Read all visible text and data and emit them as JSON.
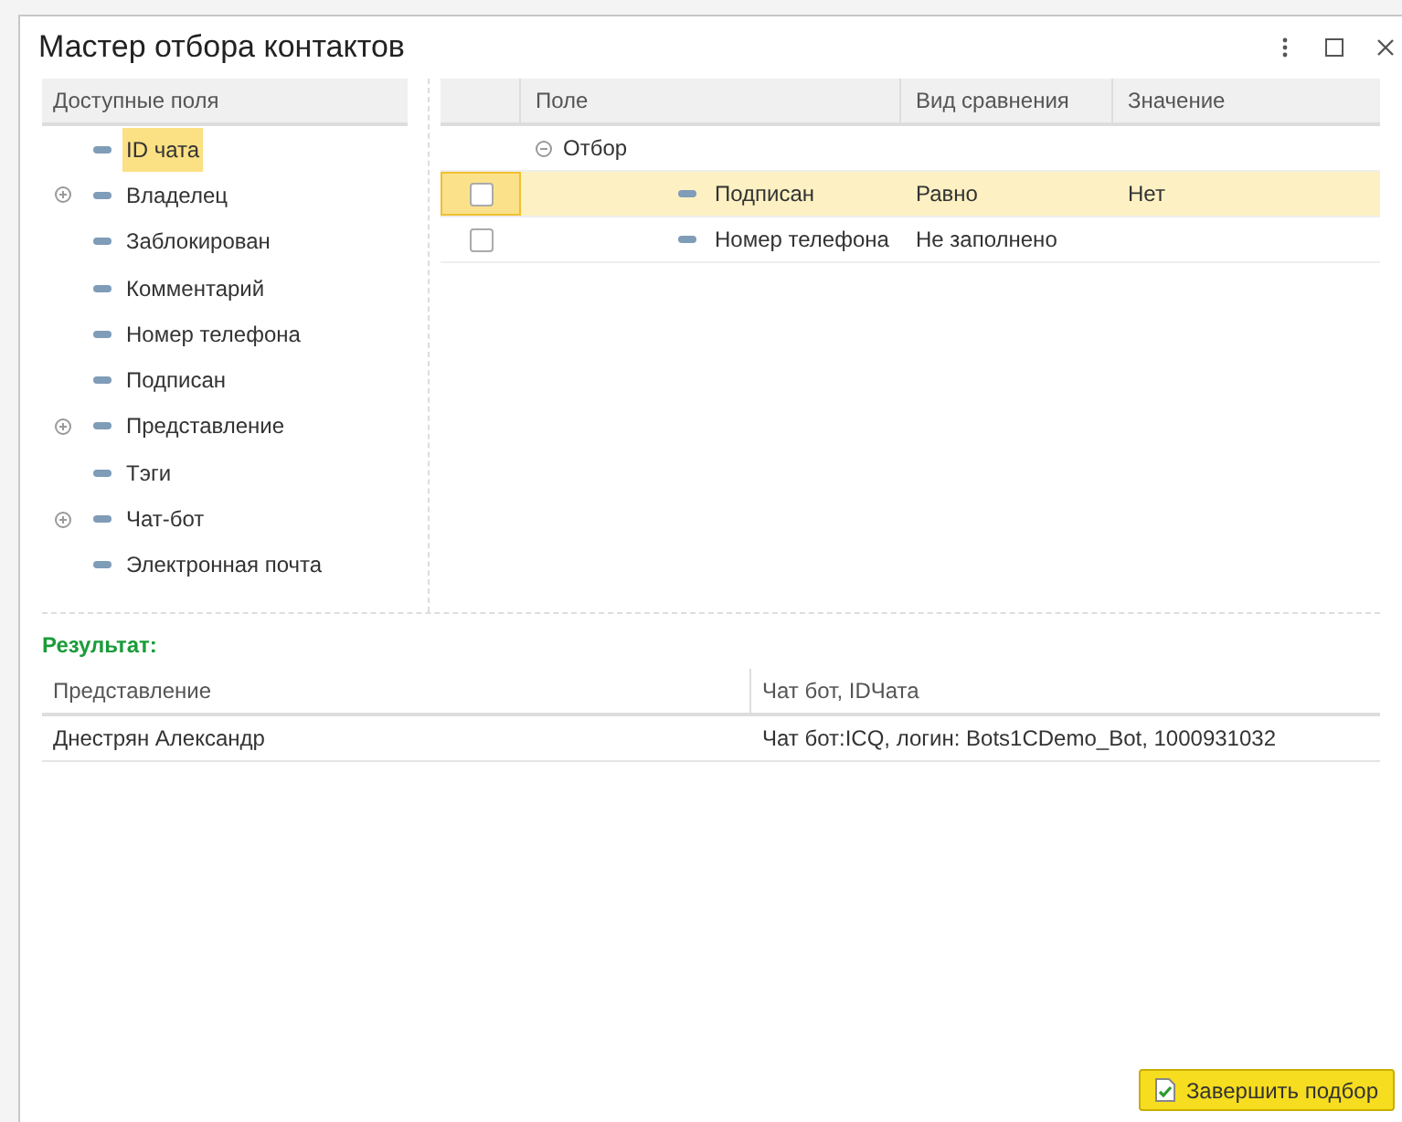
{
  "window": {
    "title": "Мастер отбора контактов"
  },
  "fields": {
    "header": "Доступные поля",
    "items": [
      {
        "label": "ID чата",
        "expandable": false,
        "selected": true
      },
      {
        "label": "Владелец",
        "expandable": true,
        "selected": false
      },
      {
        "label": "Заблокирован",
        "expandable": false,
        "selected": false
      },
      {
        "label": "Комментарий",
        "expandable": false,
        "selected": false
      },
      {
        "label": "Номер телефона",
        "expandable": false,
        "selected": false
      },
      {
        "label": "Подписан",
        "expandable": false,
        "selected": false
      },
      {
        "label": "Представление",
        "expandable": true,
        "selected": false
      },
      {
        "label": "Тэги",
        "expandable": false,
        "selected": false
      },
      {
        "label": "Чат-бот",
        "expandable": true,
        "selected": false
      },
      {
        "label": "Электронная почта",
        "expandable": false,
        "selected": false
      }
    ]
  },
  "filter": {
    "columns": [
      "Поле",
      "Вид сравнения",
      "Значение"
    ],
    "group": {
      "label": "Отбор",
      "expanded": true
    },
    "rows": [
      {
        "field": "Подписан",
        "comparison": "Равно",
        "value": "Нет",
        "checked": false,
        "selected": true
      },
      {
        "field": "Номер телефона",
        "comparison": "Не заполнено",
        "value": "",
        "checked": false,
        "selected": false
      }
    ]
  },
  "result": {
    "title": "Результат:",
    "columns": [
      "Представление",
      "Чат бот, IDЧата"
    ],
    "rows": [
      [
        "Днестрян Александр",
        "Чат бот:ICQ, логин: Bots1CDemo_Bot, 1000931032"
      ]
    ]
  },
  "buttons": [
    {
      "label": "Завершить подбор"
    }
  ]
}
